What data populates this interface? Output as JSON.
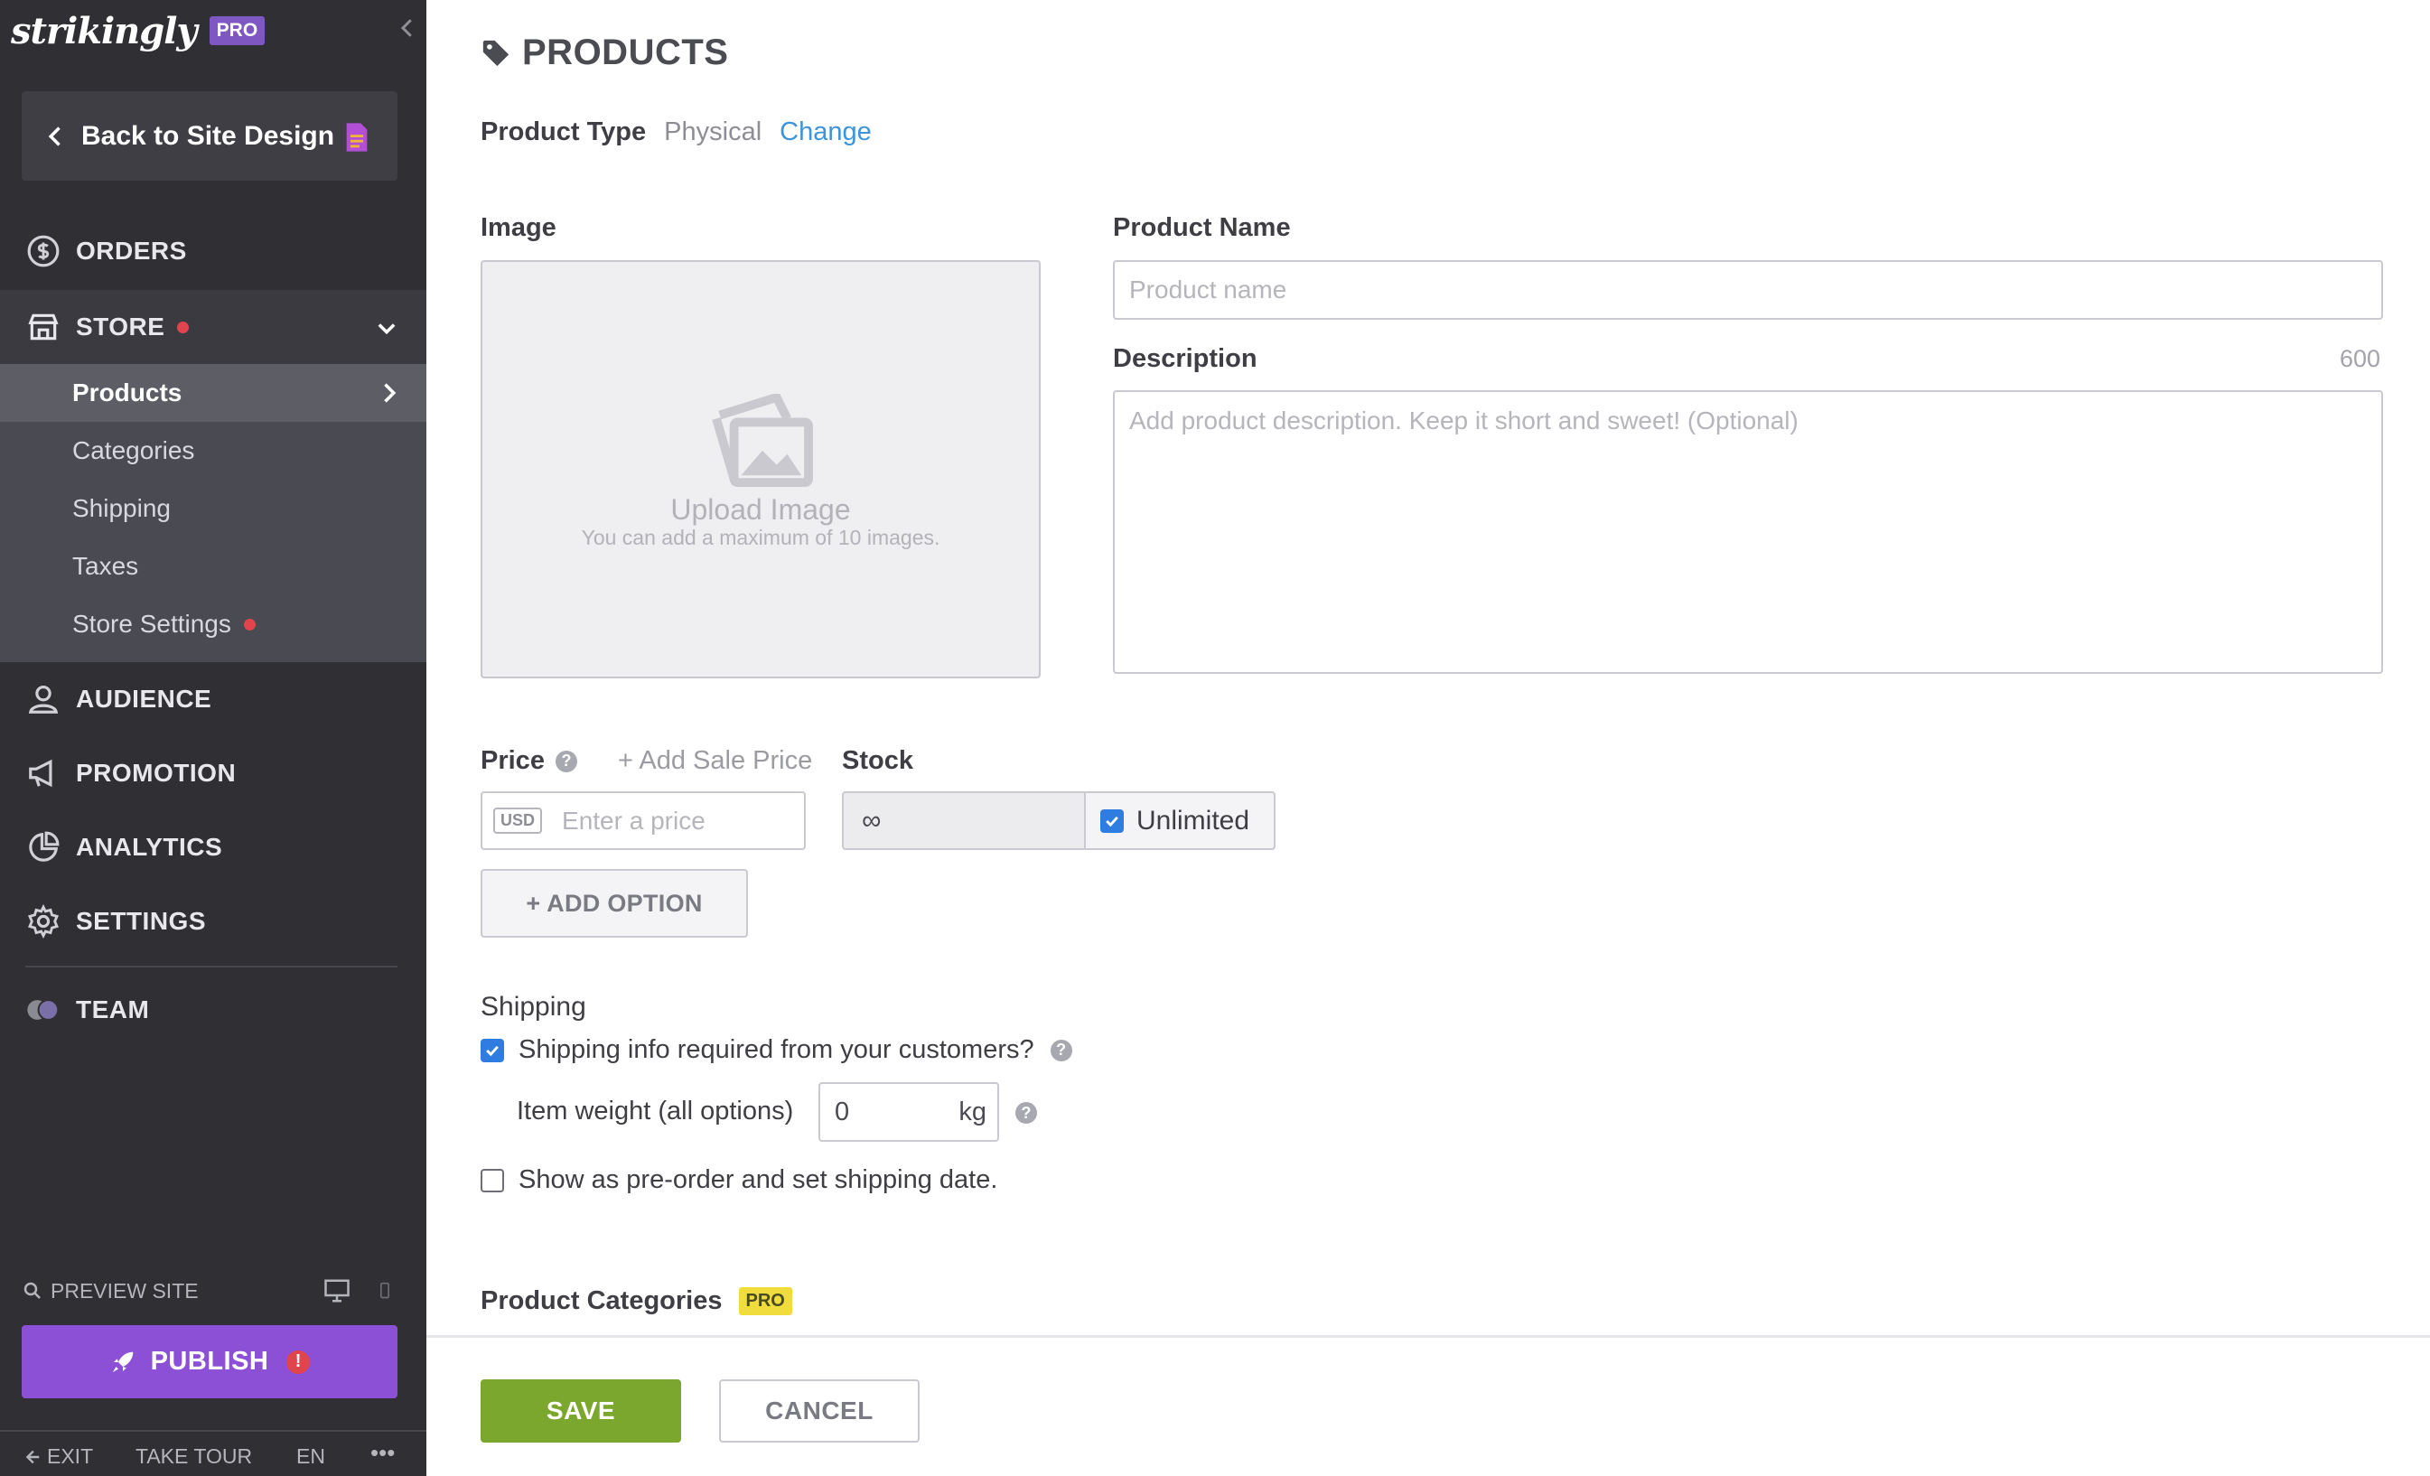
{
  "sidebar": {
    "logo": "strikingly",
    "pro_badge": "PRO",
    "back_label": "Back to Site Design",
    "nav": {
      "orders": "ORDERS",
      "store": "STORE",
      "audience": "AUDIENCE",
      "promotion": "PROMOTION",
      "analytics": "ANALYTICS",
      "settings": "SETTINGS",
      "team": "TEAM"
    },
    "store_items": [
      "Products",
      "Categories",
      "Shipping",
      "Taxes",
      "Store Settings"
    ],
    "preview_label": "PREVIEW SITE",
    "publish_label": "PUBLISH",
    "publish_alert": "!",
    "bottom": {
      "exit": "EXIT",
      "tour": "TAKE TOUR",
      "lang": "EN",
      "more": "•••"
    }
  },
  "main": {
    "title": "PRODUCTS",
    "product_type": {
      "label": "Product Type",
      "value": "Physical",
      "change": "Change"
    },
    "image": {
      "label": "Image",
      "upload": "Upload Image",
      "hint": "You can add a maximum of 10 images."
    },
    "product_name": {
      "label": "Product Name",
      "placeholder": "Product name"
    },
    "description": {
      "label": "Description",
      "counter": "600",
      "placeholder": "Add product description. Keep it short and sweet! (Optional)"
    },
    "price": {
      "label": "Price",
      "help": "?",
      "add_sale": "+ Add Sale Price",
      "currency": "USD",
      "placeholder": "Enter a price"
    },
    "stock": {
      "label": "Stock",
      "value": "∞",
      "unlimited": "Unlimited",
      "unlimited_checked": true
    },
    "add_option": "+ ADD OPTION",
    "shipping": {
      "title": "Shipping",
      "required": "Shipping info required from your customers?",
      "required_checked": true,
      "weight_label": "Item weight (all options)",
      "weight_value": "0",
      "weight_unit": "kg",
      "preorder": "Show as pre-order and set shipping date.",
      "preorder_checked": false
    },
    "categories": {
      "label": "Product Categories",
      "badge": "PRO"
    },
    "footer": {
      "save": "SAVE",
      "cancel": "CANCEL"
    }
  },
  "colors": {
    "sidebar_bg": "#2f2f34",
    "accent_purple": "#8b50d6",
    "link_blue": "#3d94d8",
    "save_green": "#7ca72e",
    "alert_red": "#e0454d",
    "pro_yellow": "#f0dc3c"
  }
}
